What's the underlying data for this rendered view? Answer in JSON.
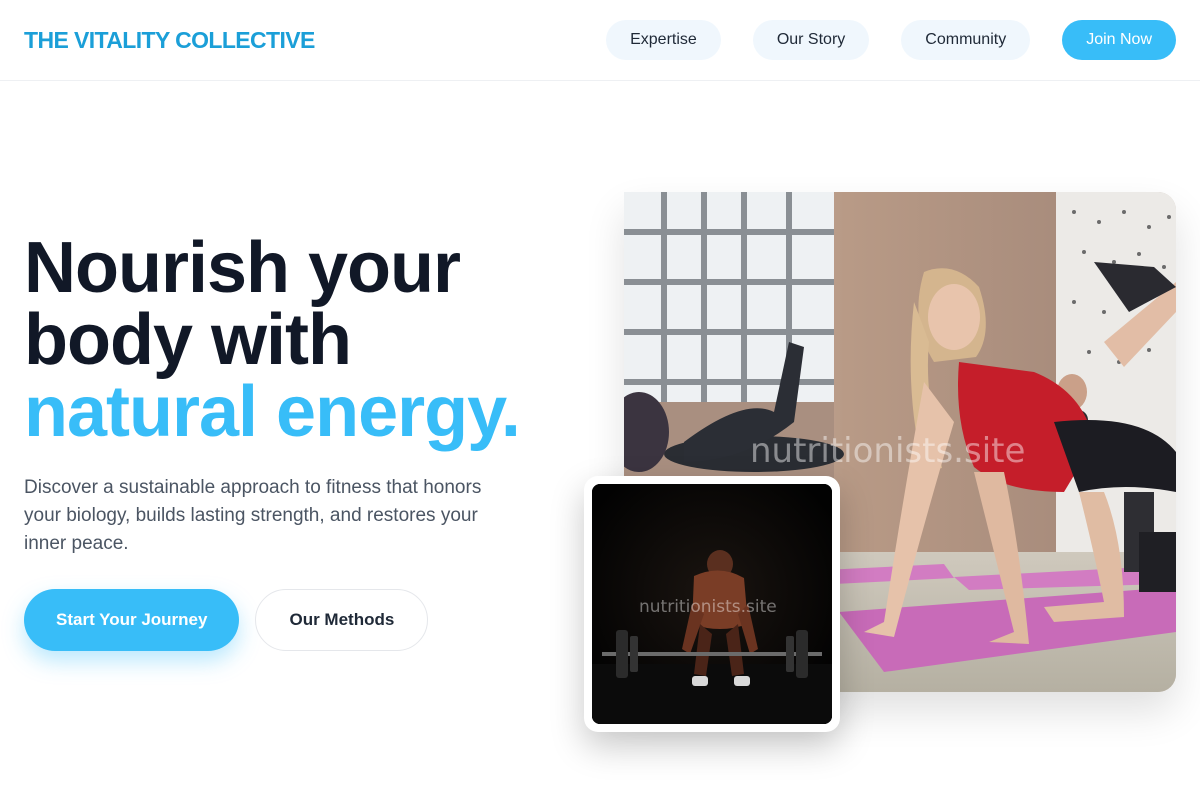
{
  "header": {
    "brand": "THE VITALITY COLLECTIVE",
    "nav": [
      "Expertise",
      "Our Story",
      "Community"
    ],
    "cta": "Join Now"
  },
  "hero": {
    "headline_line1": "Nourish your",
    "headline_line2": "body with",
    "headline_accent": "natural energy.",
    "subtext": "Discover a sustainable approach to fitness that honors your biology, builds lasting strength, and restores your inner peace.",
    "primary_button": "Start Your Journey",
    "secondary_button": "Our Methods"
  },
  "images": {
    "main_photo_alt": "Woman doing a kneeling kickback exercise on a pink mat in a group fitness class",
    "main_watermark": "nutritionists.site",
    "inset_photo_alt": "Man performing a deadlift with a barbell in a dark gym",
    "inset_watermark": "nutritionists.site"
  },
  "colors": {
    "brand": "#1b9fd8",
    "accent": "#38bdf8",
    "headline": "#111827",
    "body_text": "#4b5563",
    "nav_pill_bg": "#f0f7fd"
  }
}
